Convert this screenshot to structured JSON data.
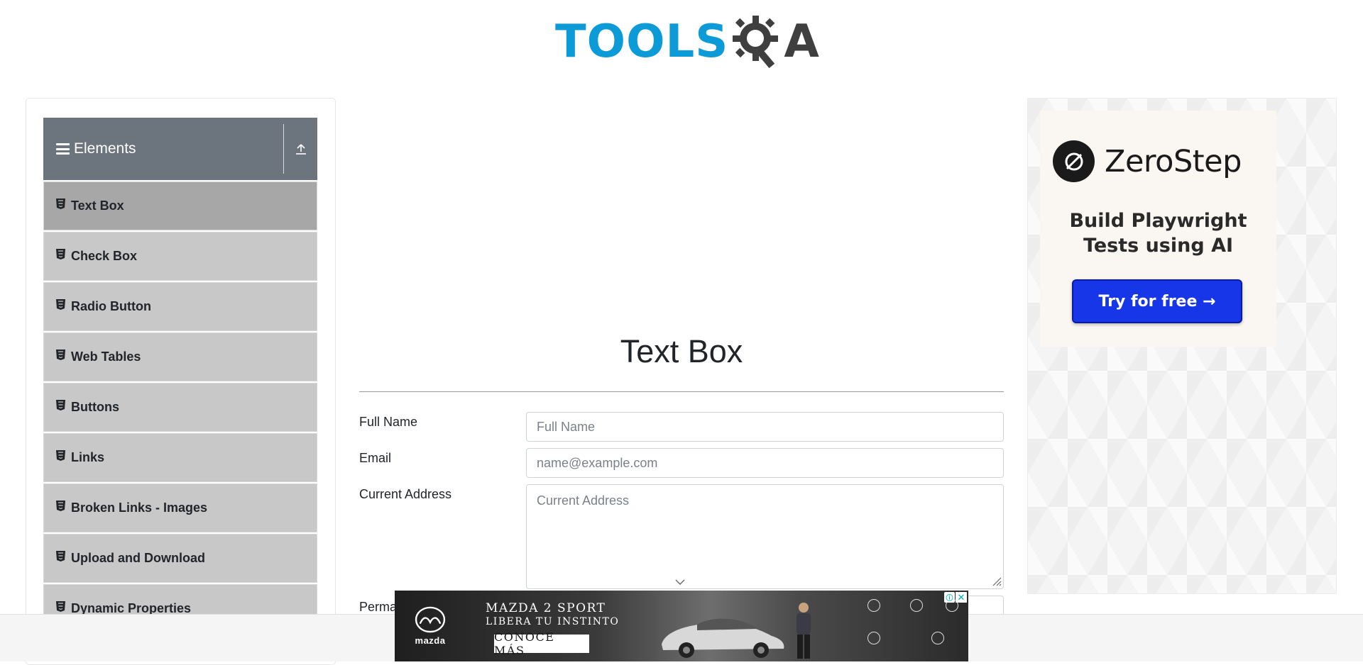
{
  "header": {
    "logo_left": "TOOLS",
    "logo_right": "A",
    "logo_alt": "TOOLSQA"
  },
  "sidebar": {
    "group_title": "Elements",
    "items": [
      {
        "label": "Text Box",
        "active": true
      },
      {
        "label": "Check Box"
      },
      {
        "label": "Radio Button"
      },
      {
        "label": "Web Tables"
      },
      {
        "label": "Buttons"
      },
      {
        "label": "Links"
      },
      {
        "label": "Broken Links - Images"
      },
      {
        "label": "Upload and Download"
      },
      {
        "label": "Dynamic Properties"
      }
    ]
  },
  "main": {
    "title": "Text Box",
    "fields": {
      "full_name": {
        "label": "Full Name",
        "placeholder": "Full Name",
        "value": ""
      },
      "email": {
        "label": "Email",
        "placeholder": "name@example.com",
        "value": ""
      },
      "current_address": {
        "label": "Current Address",
        "placeholder": "Current Address",
        "value": ""
      },
      "permanent_address": {
        "label_visible": "Perma"
      }
    }
  },
  "right_ad": {
    "brand": "ZeroStep",
    "tagline_line1": "Build Playwright",
    "tagline_line2": "Tests using AI",
    "cta": "Try for free →",
    "cta_color": "#1636e8"
  },
  "bottom_ad": {
    "brand": "mazda",
    "headline_line1": "MAZDA 2 SPORT",
    "headline_line2": "LIBERA TU INSTINTO",
    "cta": "CONOCE MÁS",
    "info_icon": "ⓘ",
    "close_icon": "✕"
  },
  "colors": {
    "brand_blue": "#0d9bd8",
    "nav_header": "#6c757d",
    "nav_item": "#c8c8c8",
    "nav_item_active": "#a7a7a7"
  }
}
